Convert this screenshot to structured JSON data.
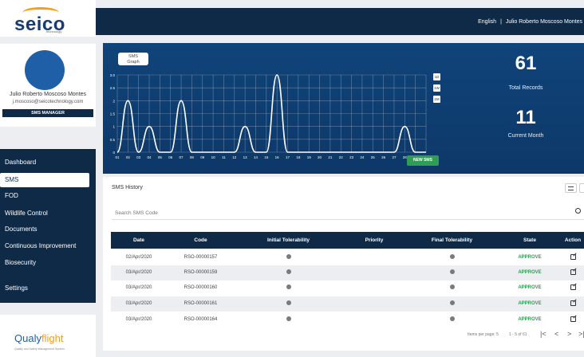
{
  "brand": {
    "logo_text": "seico",
    "logo_sub": "technology"
  },
  "topbar": {
    "language": "English",
    "separator": "|",
    "user_name": "Julio Roberto Moscoso Montes"
  },
  "profile": {
    "name": "Julio Roberto Moscoso Montes",
    "email": "j.moscoso@seicotechnology.com",
    "role": "SMS MANAGER"
  },
  "sidebar": {
    "items": [
      {
        "label": "Dashboard"
      },
      {
        "label": "SMS"
      },
      {
        "label": "FOD"
      },
      {
        "label": "Wildlife Control"
      },
      {
        "label": "Documents"
      },
      {
        "label": "Continuous Improvement"
      },
      {
        "label": "Biosecurity"
      },
      {
        "label": "Settings"
      }
    ],
    "active": "SMS"
  },
  "qualyflight": {
    "logo_text_1": "Qualy",
    "logo_text_2": "flight",
    "logo_sub": "Quality and Safety Management System"
  },
  "graph": {
    "button_label_1": "SMS",
    "button_label_2": "Graph",
    "toggles": [
      "1D",
      "1W",
      "1M"
    ],
    "line_color": "#ffffff"
  },
  "stats": {
    "total_value": "61",
    "total_label": "Total Records",
    "month_value": "11",
    "month_label": "Current Month",
    "new_button": "NEW SMS"
  },
  "chart_data": {
    "type": "line",
    "x": [
      "01",
      "02",
      "03",
      "04",
      "05",
      "06",
      "07",
      "08",
      "09",
      "10",
      "11",
      "12",
      "13",
      "14",
      "15",
      "16",
      "17",
      "18",
      "19",
      "20",
      "21",
      "22",
      "23",
      "24",
      "25",
      "26",
      "27",
      "28",
      "29",
      "30"
    ],
    "series": [
      {
        "values": [
          0,
          2,
          0,
          1,
          0,
          0,
          2,
          0,
          0,
          0,
          0,
          0,
          1,
          0,
          0,
          3,
          0,
          0,
          0,
          0,
          0,
          0,
          0,
          0,
          0,
          0,
          0,
          1,
          0,
          0
        ]
      }
    ],
    "yticks": [
      "0",
      "0.5",
      "1",
      "1.5",
      "2",
      "2.5",
      "3.0"
    ],
    "ylim": [
      0,
      3
    ],
    "grid": true
  },
  "history": {
    "title": "SMS History",
    "search_placeholder": "Search SMS Code",
    "columns": [
      "Date",
      "Code",
      "Initial Tolerability",
      "Priority",
      "Final Tolerability",
      "State",
      "Action"
    ],
    "rows": [
      {
        "date": "02/Apr/2020",
        "code": "RSO-00000157",
        "state": "APPROVE"
      },
      {
        "date": "03/Apr/2020",
        "code": "RSO-00000159",
        "state": "APPROVE"
      },
      {
        "date": "03/Apr/2020",
        "code": "RSO-00000160",
        "state": "APPROVE"
      },
      {
        "date": "03/Apr/2020",
        "code": "RSO-00000161",
        "state": "APPROVE"
      },
      {
        "date": "03/Apr/2020",
        "code": "RSO-00000164",
        "state": "APPROVE"
      }
    ],
    "pager": {
      "items_per_page": "Items per page: 5",
      "range": "1 - 5 of 61"
    }
  }
}
